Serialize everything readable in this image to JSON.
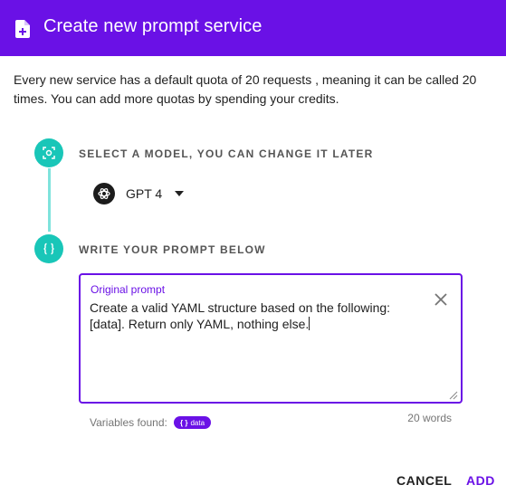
{
  "dialog": {
    "title": "Create new prompt service",
    "intro": "Every new service has a default quota of 20 requests , meaning it can be called 20 times. You can add more quotas by spending your credits.",
    "accent_color": "#6a11e6",
    "step_color": "#19c6b8"
  },
  "steps": {
    "model": {
      "title": "SELECT A MODEL, YOU CAN CHANGE IT LATER",
      "icon": "ai-chip-icon",
      "selected_model": "GPT 4",
      "model_icon": "openai-logo-icon"
    },
    "prompt": {
      "title": "WRITE YOUR PROMPT BELOW",
      "icon": "curly-braces-icon",
      "field_label": "Original prompt",
      "field_value": "Create a valid YAML structure based on the following: [data]. Return only YAML, nothing else.",
      "variables_label": "Variables found:",
      "variable_chip": "data",
      "word_count": "20 words"
    }
  },
  "actions": {
    "cancel_label": "CANCEL",
    "add_label": "ADD"
  }
}
